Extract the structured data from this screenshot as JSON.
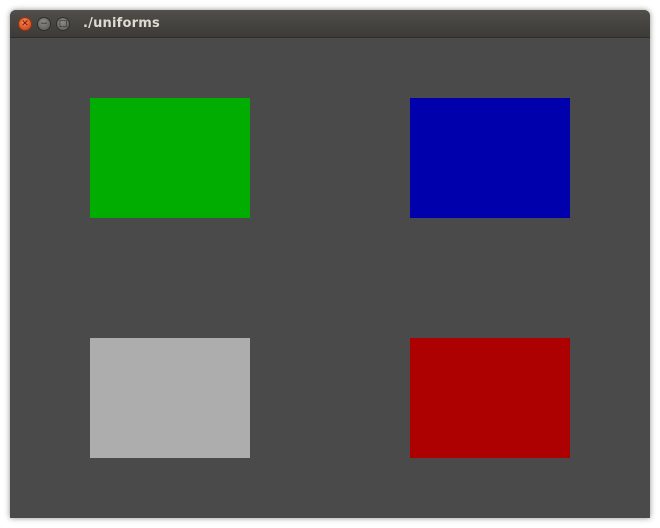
{
  "window": {
    "title": "./uniforms",
    "controls": {
      "close_icon": "close-icon",
      "minimize_icon": "minimize-icon",
      "maximize_icon": "maximize-icon"
    }
  },
  "canvas": {
    "background_color": "#4a4a4a",
    "quads": [
      {
        "color": "#00ad00"
      },
      {
        "color": "#0000ad"
      },
      {
        "color": "#adadad"
      },
      {
        "color": "#ad0000"
      }
    ]
  }
}
